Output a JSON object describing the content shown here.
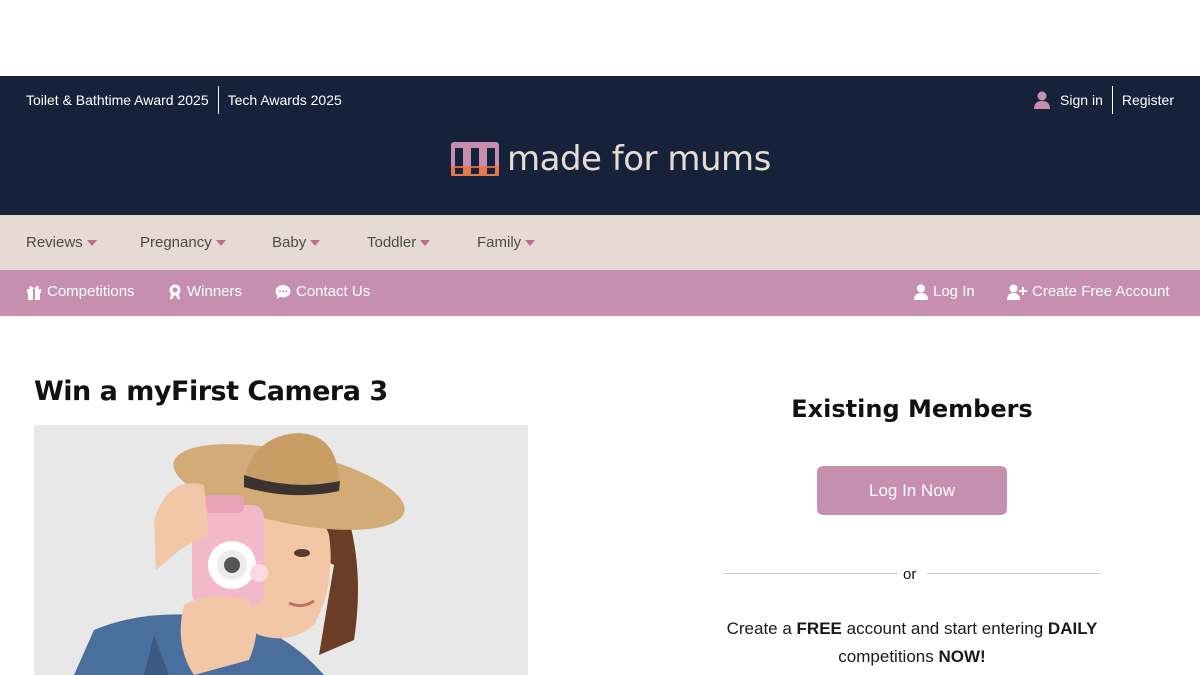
{
  "top_bar": {
    "links": [
      "Toilet & Bathtime Award 2025",
      "Tech Awards 2025"
    ],
    "sign_in": "Sign in",
    "register": "Register"
  },
  "logo": {
    "text": "made for mums"
  },
  "main_nav": {
    "items": [
      "Reviews",
      "Pregnancy",
      "Baby",
      "Toddler",
      "Family"
    ]
  },
  "sub_nav": {
    "competitions": "Competitions",
    "winners": "Winners",
    "contact": "Contact Us",
    "log_in": "Log In",
    "create_account": "Create Free Account"
  },
  "article": {
    "title": "Win a myFirst Camera 3",
    "image_alt": "child holding pink camera wearing straw hat"
  },
  "sidebar": {
    "heading": "Existing Members",
    "login_button": "Log In Now",
    "or": "or",
    "promo_1": "Create a ",
    "promo_free": "FREE",
    "promo_2": " account and start entering ",
    "promo_daily": "DAILY",
    "promo_3": " competitions ",
    "promo_now": "NOW!"
  },
  "colors": {
    "navy": "#16213a",
    "beige": "#e6dbd4",
    "pink": "#c68fb0",
    "accent_caret": "#c06a90"
  }
}
